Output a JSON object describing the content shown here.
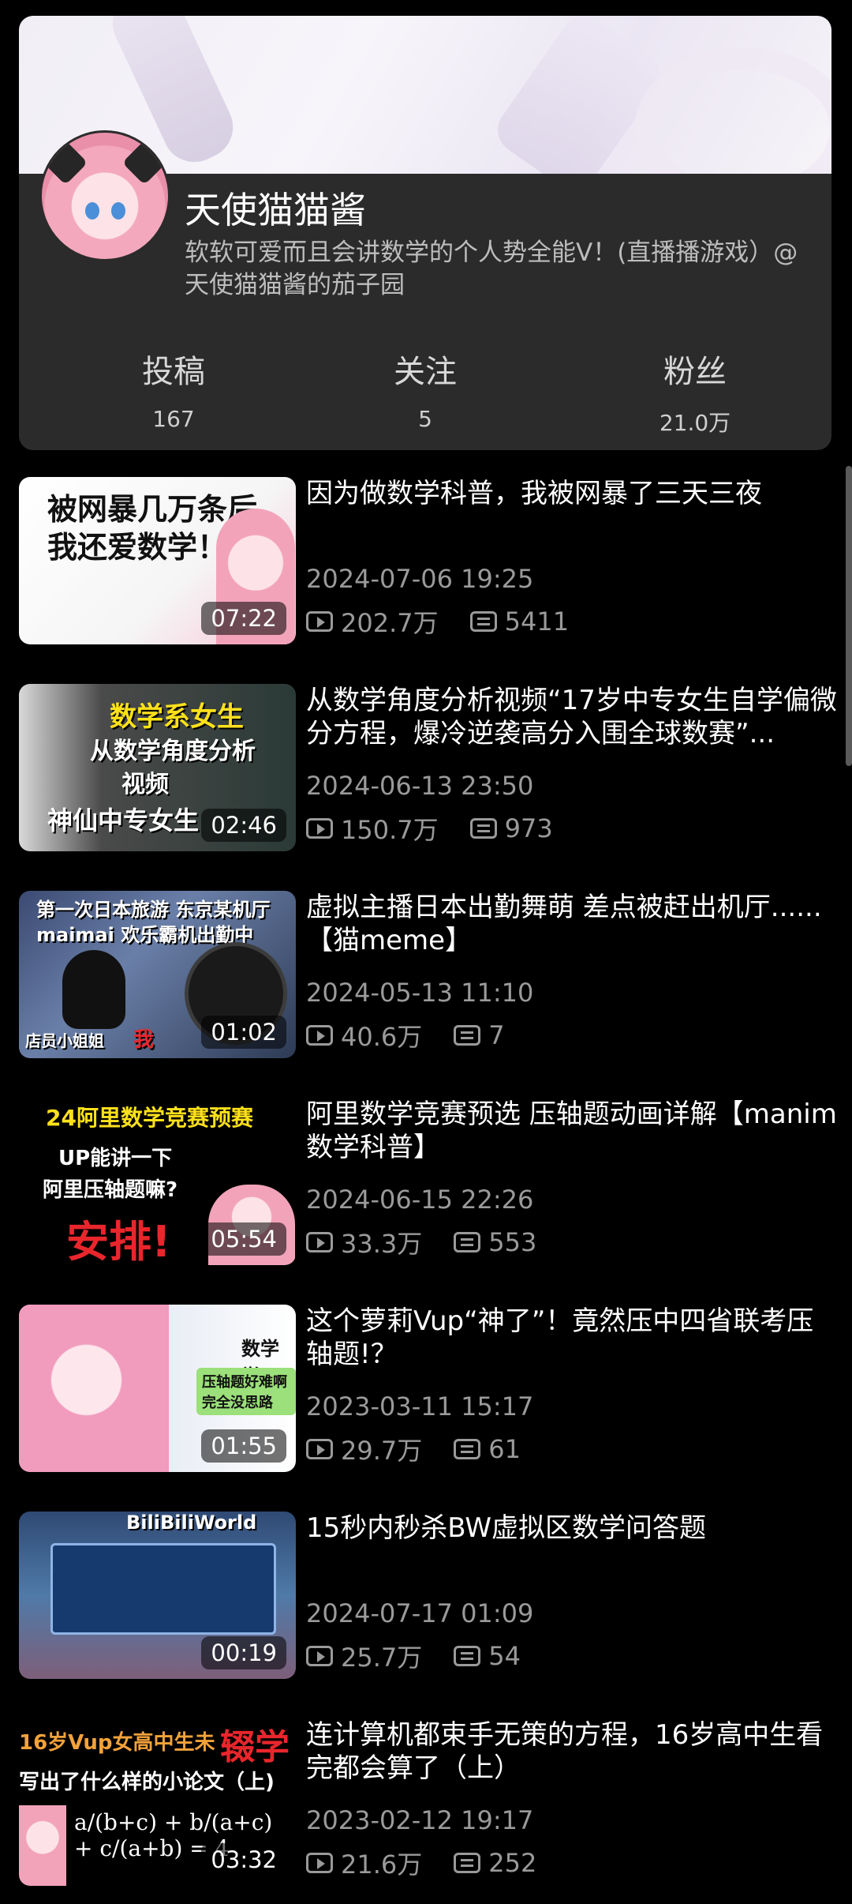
{
  "profile": {
    "name": "天使猫猫酱",
    "bio": "软软可爱而且会讲数学的个人势全能V！(直播播游戏）@天使猫猫酱的茄子园",
    "stats": [
      {
        "label": "投稿",
        "value": "167"
      },
      {
        "label": "关注",
        "value": "5"
      },
      {
        "label": "粉丝",
        "value": "21.0万"
      }
    ]
  },
  "videos": [
    {
      "title": "因为做数学科普，我被网暴了三天三夜",
      "date": "2024-07-06 19:25",
      "views": "202.7万",
      "comments": "5411",
      "duration": "07:22",
      "thumb_text": [
        "被网暴几万条后",
        "我还爱数学！"
      ]
    },
    {
      "title": "从数学角度分析视频“17岁中专女生自学偏微分方程，爆冷逆袭高分入围全球数赛”...",
      "date": "2024-06-13 23:50",
      "views": "150.7万",
      "comments": "973",
      "duration": "02:46",
      "thumb_text": [
        "数学系女生",
        "从数学角度分析",
        "视频",
        "神仙中专女生"
      ]
    },
    {
      "title": "虚拟主播日本出勤舞萌 差点被赶出机厅......【猫meme】",
      "date": "2024-05-13 11:10",
      "views": "40.6万",
      "comments": "7",
      "duration": "01:02",
      "thumb_text": [
        "第一次日本旅游 东京某机厅",
        "maimai 欢乐霸机出勤中",
        "店员小姐姐",
        "我"
      ]
    },
    {
      "title": "阿里数学竞赛预选 压轴题动画详解【manim数学科普】",
      "date": "2024-06-15 22:26",
      "views": "33.3万",
      "comments": "553",
      "duration": "05:54",
      "thumb_text": [
        "24阿里数学竞赛预赛",
        "UP能讲一下",
        "阿里压轴题嘛?",
        "安排!"
      ]
    },
    {
      "title": "这个萝莉Vup“神了”！竟然压中四省联考压轴题!？",
      "date": "2023-03-11 15:17",
      "views": "29.7万",
      "comments": "61",
      "duration": "01:55",
      "thumb_text": [
        "数学学",
        "压轴题好难啊",
        "完全没思路"
      ]
    },
    {
      "title": "15秒内秒杀BW虚拟区数学问答题",
      "date": "2024-07-17 01:09",
      "views": "25.7万",
      "comments": "54",
      "duration": "00:19",
      "thumb_text": [
        "BiliBiliWorld"
      ]
    },
    {
      "title": "连计算机都束手无策的方程，16岁高中生看完都会算了（上）",
      "date": "2023-02-12 19:17",
      "views": "21.6万",
      "comments": "252",
      "duration": "03:32",
      "thumb_text": [
        "16岁Vup女高中生未",
        "辍学",
        "写出了什么样的小论文（上)"
      ]
    }
  ],
  "colors": {
    "background": "#000000",
    "card": "#2b2b2b",
    "meta": "#9a9a9a",
    "accent_red": "#e8262c",
    "accent_yellow": "#ffe11a"
  },
  "icons": {
    "views": "play-icon",
    "comments": "comment-icon"
  }
}
